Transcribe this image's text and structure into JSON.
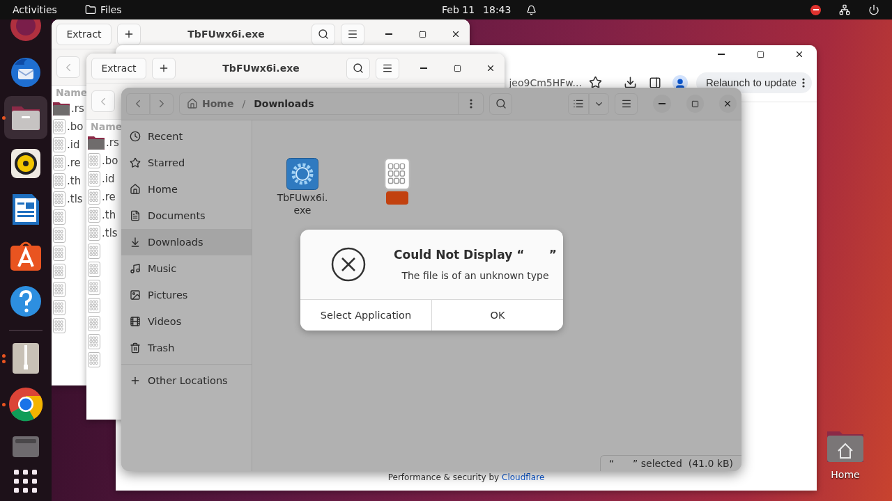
{
  "top_bar": {
    "activities": "Activities",
    "app": "Files",
    "date": "Feb 11",
    "time": "18:43"
  },
  "dock": {
    "items": [
      {
        "kind": "firefox",
        "active": false,
        "running": false,
        "multiple": false
      },
      {
        "kind": "thunderbird",
        "active": false,
        "running": false,
        "multiple": false
      },
      {
        "kind": "files",
        "active": true,
        "running": true,
        "multiple": false
      },
      {
        "kind": "rhythmbox",
        "active": false,
        "running": false,
        "multiple": false
      },
      {
        "kind": "writer",
        "active": false,
        "running": false,
        "multiple": false
      },
      {
        "kind": "software",
        "active": false,
        "running": false,
        "multiple": false
      },
      {
        "kind": "help",
        "active": false,
        "running": false,
        "multiple": false
      },
      {
        "kind": "separator"
      },
      {
        "kind": "archive",
        "active": false,
        "running": true,
        "multiple": true
      },
      {
        "kind": "chrome",
        "active": false,
        "running": true,
        "multiple": false
      },
      {
        "kind": "drive",
        "active": false,
        "running": false,
        "multiple": false
      },
      {
        "kind": "apps",
        "active": false,
        "running": false,
        "multiple": false
      }
    ]
  },
  "archive_windows": [
    {
      "title": "TbFUwx6i.exe",
      "extract": "Extract",
      "column": "Name",
      "files": [
        {
          "kind": "folder",
          "name": ".rs"
        },
        {
          "kind": "binary",
          "name": ".bo"
        },
        {
          "kind": "binary",
          "name": ".id"
        },
        {
          "kind": "binary",
          "name": ".re"
        },
        {
          "kind": "binary",
          "name": ".th"
        },
        {
          "kind": "binary",
          "name": ".tls"
        },
        {
          "kind": "binary"
        },
        {
          "kind": "binary"
        },
        {
          "kind": "binary"
        },
        {
          "kind": "binary"
        },
        {
          "kind": "binary"
        },
        {
          "kind": "binary"
        },
        {
          "kind": "binary"
        }
      ]
    },
    {
      "title": "TbFUwx6i.exe",
      "extract": "Extract",
      "column": "Name",
      "files": [
        {
          "kind": "folder",
          "name": ".rs"
        },
        {
          "kind": "binary",
          "name": ".bo"
        },
        {
          "kind": "binary",
          "name": ".id"
        },
        {
          "kind": "binary",
          "name": ".re"
        },
        {
          "kind": "binary",
          "name": ".th"
        },
        {
          "kind": "binary",
          "name": ".tls"
        },
        {
          "kind": "binary"
        },
        {
          "kind": "binary"
        },
        {
          "kind": "binary"
        },
        {
          "kind": "binary"
        },
        {
          "kind": "binary"
        },
        {
          "kind": "binary"
        },
        {
          "kind": "binary"
        }
      ]
    }
  ],
  "browser": {
    "address": "jeo9Cm5HFw...",
    "relaunch": "Relaunch to update",
    "footer_text": "Performance & security by ",
    "footer_link": "Cloudflare"
  },
  "files": {
    "path": [
      "Home",
      "Downloads"
    ],
    "path_separator": "/",
    "sidebar": [
      {
        "kind": "recent",
        "label": "Recent",
        "selected": false
      },
      {
        "kind": "starred",
        "label": "Starred",
        "selected": false
      },
      {
        "kind": "home",
        "label": "Home",
        "selected": false
      },
      {
        "kind": "documents",
        "label": "Documents",
        "selected": false
      },
      {
        "kind": "downloads",
        "label": "Downloads",
        "selected": true
      },
      {
        "kind": "music",
        "label": "Music",
        "selected": false
      },
      {
        "kind": "pictures",
        "label": "Pictures",
        "selected": false
      },
      {
        "kind": "videos",
        "label": "Videos",
        "selected": false
      },
      {
        "kind": "trash",
        "label": "Trash",
        "selected": false
      }
    ],
    "other_locations": "Other Locations",
    "items": [
      {
        "kind": "executable",
        "name": "TbFUwx6i.exe",
        "selected": false
      },
      {
        "kind": "binary",
        "selected": true
      }
    ],
    "status": "“      ” selected  (41.0 kB)"
  },
  "dialog": {
    "title": "Could Not Display “      ”",
    "message": "The file is of an unknown type",
    "buttons": [
      "Select Application",
      "OK"
    ]
  },
  "desktop": {
    "icons": [
      {
        "label": "Home"
      }
    ]
  }
}
